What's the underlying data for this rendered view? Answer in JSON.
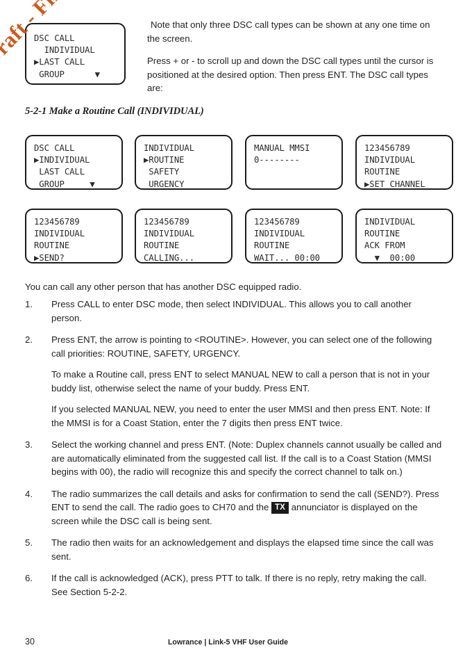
{
  "watermark": {
    "text": "Draft - Final approval",
    "color": "#cc5a1e"
  },
  "intro": {
    "note": "Note that only three DSC call types can be shown at any one time on the screen.",
    "press": "Press + or - to scroll up and down the DSC call types until the cursor is positioned at the desired option. Then press ENT. The DSC call types are:"
  },
  "section": {
    "heading": "5-2-1 Make a Routine Call (INDIVIDUAL)"
  },
  "lead": "You can call any other person that has another DSC equipped radio.",
  "lcd_top": {
    "name": "dsc-call-list-last-call",
    "lines": [
      "DSC CALL",
      "  INDIVIDUAL",
      "▶LAST CALL",
      " GROUP      ▼"
    ]
  },
  "lcd_panels": [
    {
      "name": "dsc-call-list-individual",
      "lines": [
        "DSC CALL",
        "▶INDIVIDUAL",
        " LAST CALL",
        " GROUP     ▼"
      ]
    },
    {
      "name": "call-priority-routine",
      "lines": [
        "INDIVIDUAL",
        "▶ROUTINE",
        " SAFETY",
        " URGENCY"
      ]
    },
    {
      "name": "manual-mmsi-entry",
      "lines": [
        "MANUAL MMSI",
        "0--------",
        "",
        ""
      ]
    },
    {
      "name": "set-channel-prompt",
      "lines": [
        "123456789",
        "INDIVIDUAL",
        "ROUTINE",
        "▶SET CHANNEL"
      ]
    },
    {
      "name": "send-confirm-prompt",
      "lines": [
        "123456789",
        "INDIVIDUAL",
        "ROUTINE",
        "▶SEND?"
      ]
    },
    {
      "name": "calling-status",
      "lines": [
        "123456789",
        "INDIVIDUAL",
        "ROUTINE",
        "CALLING..."
      ]
    },
    {
      "name": "wait-status",
      "lines": [
        "123456789",
        "INDIVIDUAL",
        "ROUTINE",
        "WAIT... 00:00"
      ]
    },
    {
      "name": "ack-from-status",
      "lines": [
        "INDIVIDUAL",
        "ROUTINE",
        "ACK FROM",
        "  ▼  00:00"
      ]
    }
  ],
  "steps": [
    {
      "num": "1.",
      "paras": [
        "Press CALL to enter DSC mode, then select INDIVIDUAL. This allows you to call another person."
      ]
    },
    {
      "num": "2.",
      "paras": [
        "Press ENT, the arrow is pointing to <ROUTINE>. However, you can select one of the following call priorities: ROUTINE, SAFETY, URGENCY.",
        "To make a Routine call, press ENT to select MANUAL NEW to call a person that is not in your buddy list, otherwise select the name of your buddy. Press ENT.",
        "If you selected MANUAL NEW, you need to enter the user MMSI and then press ENT. Note: If the MMSI is for a Coast Station, enter the 7 digits then press ENT twice."
      ]
    },
    {
      "num": "3.",
      "paras": [
        "Select the working channel and press ENT. (Note: Duplex channels cannot usually be called and are automatically eliminated from the suggested call list. If the call is to a Coast Station (MMSI begins with 00), the radio will recognize this and specify the correct channel to talk on.)"
      ]
    },
    {
      "num": "4.",
      "paras": [
        "The radio summarizes the call details and asks for confirmation to send the call (SEND?). Press ENT to send the call. The radio goes to CH70 and the ||TX|| annunciator is displayed on the screen while the DSC call is being sent."
      ]
    },
    {
      "num": "5.",
      "paras": [
        "The radio then waits for an acknowledgement and displays the elapsed time since the call was sent."
      ]
    },
    {
      "num": "6.",
      "paras": [
        "If the call is acknowledged (ACK), press PTT to talk. If there is no reply, retry making the call. See Section 5-2-2."
      ]
    }
  ],
  "badge": {
    "tx": "TX"
  },
  "footer": {
    "page": "30",
    "title": "Lowrance | Link-5 VHF User Guide"
  }
}
